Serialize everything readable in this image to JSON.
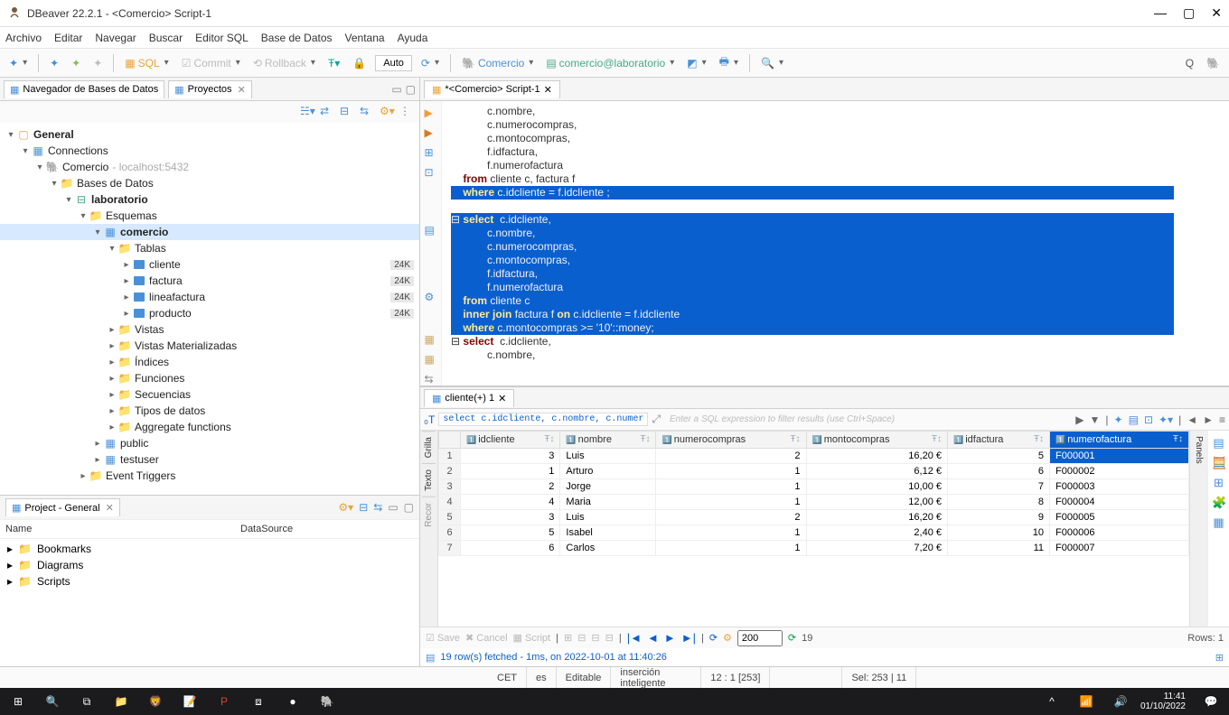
{
  "window": {
    "title": "DBeaver 22.2.1 - <Comercio> Script-1"
  },
  "menu": [
    "Archivo",
    "Editar",
    "Navegar",
    "Buscar",
    "Editor SQL",
    "Base de Datos",
    "Ventana",
    "Ayuda"
  ],
  "toolbar": {
    "sql": "SQL",
    "commit": "Commit",
    "rollback": "Rollback",
    "auto": "Auto",
    "connection": "Comercio",
    "database": "comercio@laboratorio"
  },
  "navigator": {
    "tabs": {
      "db": "Navegador de Bases de Datos",
      "projects": "Proyectos"
    },
    "root": "General",
    "connections": "Connections",
    "comercio": "Comercio",
    "comercio_host": "- localhost:5432",
    "databases": "Bases de Datos",
    "laboratorio": "laboratorio",
    "esquemas": "Esquemas",
    "schema_comercio": "comercio",
    "tablas": "Tablas",
    "tables": [
      {
        "name": "cliente",
        "size": "24K"
      },
      {
        "name": "factura",
        "size": "24K"
      },
      {
        "name": "lineafactura",
        "size": "24K"
      },
      {
        "name": "producto",
        "size": "24K"
      }
    ],
    "folders": [
      "Vistas",
      "Vistas Materializadas",
      "Índices",
      "Funciones",
      "Secuencias",
      "Tipos de datos",
      "Aggregate functions"
    ],
    "schema_public": "public",
    "schema_testuser": "testuser",
    "event_triggers": "Event Triggers"
  },
  "project_panel": {
    "title": "Project - General",
    "cols": {
      "name": "Name",
      "datasource": "DataSource"
    },
    "items": [
      "Bookmarks",
      "Diagrams",
      "Scripts"
    ]
  },
  "editor": {
    "tab": "*<Comercio> Script-1",
    "lines_top": [
      "            c.nombre,",
      "            c.numerocompras,",
      "            c.montocompras,",
      "            f.idfactura,",
      "            f.numerofactura"
    ],
    "from_line": "    from cliente c, factura f",
    "sel_block1": [
      "    where c.idcliente = f.idcliente ;",
      "",
      "⊟ select  c.idcliente,",
      "            c.nombre,",
      "            c.numerocompras,",
      "            c.montocompras,",
      "            f.idfactura,",
      "            f.numerofactura",
      "    from cliente c",
      "    inner join factura f on c.idcliente = f.idcliente",
      "    where c.montocompras >= '10'::money;"
    ],
    "after_sel": [
      "",
      "⊟ select  c.idcliente,",
      "            c.nombre,"
    ]
  },
  "results": {
    "tab": "cliente(+) 1",
    "sql_echo": "select c.idcliente, c.nombre, c.numer",
    "filter_placeholder": "Enter a SQL expression to filter results (use Ctrl+Space)",
    "columns": [
      "idcliente",
      "nombre",
      "numerocompras",
      "montocompras",
      "idfactura",
      "numerofactura"
    ],
    "rows": [
      {
        "n": 1,
        "idcliente": 3,
        "nombre": "Luis",
        "numerocompras": 2,
        "montocompras": "16,20 €",
        "idfactura": 5,
        "numerofactura": "F000001"
      },
      {
        "n": 2,
        "idcliente": 1,
        "nombre": "Arturo",
        "numerocompras": 1,
        "montocompras": "6,12 €",
        "idfactura": 6,
        "numerofactura": "F000002"
      },
      {
        "n": 3,
        "idcliente": 2,
        "nombre": "Jorge",
        "numerocompras": 1,
        "montocompras": "10,00 €",
        "idfactura": 7,
        "numerofactura": "F000003"
      },
      {
        "n": 4,
        "idcliente": 4,
        "nombre": "Maria",
        "numerocompras": 1,
        "montocompras": "12,00 €",
        "idfactura": 8,
        "numerofactura": "F000004"
      },
      {
        "n": 5,
        "idcliente": 3,
        "nombre": "Luis",
        "numerocompras": 2,
        "montocompras": "16,20 €",
        "idfactura": 9,
        "numerofactura": "F000005"
      },
      {
        "n": 6,
        "idcliente": 5,
        "nombre": "Isabel",
        "numerocompras": 1,
        "montocompras": "2,40 €",
        "idfactura": 10,
        "numerofactura": "F000006"
      },
      {
        "n": 7,
        "idcliente": 6,
        "nombre": "Carlos",
        "numerocompras": 1,
        "montocompras": "7,20 €",
        "idfactura": 11,
        "numerofactura": "F000007"
      }
    ],
    "footer": {
      "save": "Save",
      "cancel": "Cancel",
      "script": "Script",
      "page": "200",
      "count": "19",
      "rows_label": "Rows: 1"
    },
    "fetch_status": "19 row(s) fetched - 1ms, on 2022-10-01 at 11:40:26"
  },
  "statusbar": {
    "tz": "CET",
    "lang": "es",
    "mode": "Editable",
    "insert": "inserción inteligente",
    "pos": "12 : 1 [253]",
    "sel": "Sel: 253 | 11"
  },
  "clock": {
    "time": "11:41",
    "date": "01/10/2022"
  }
}
